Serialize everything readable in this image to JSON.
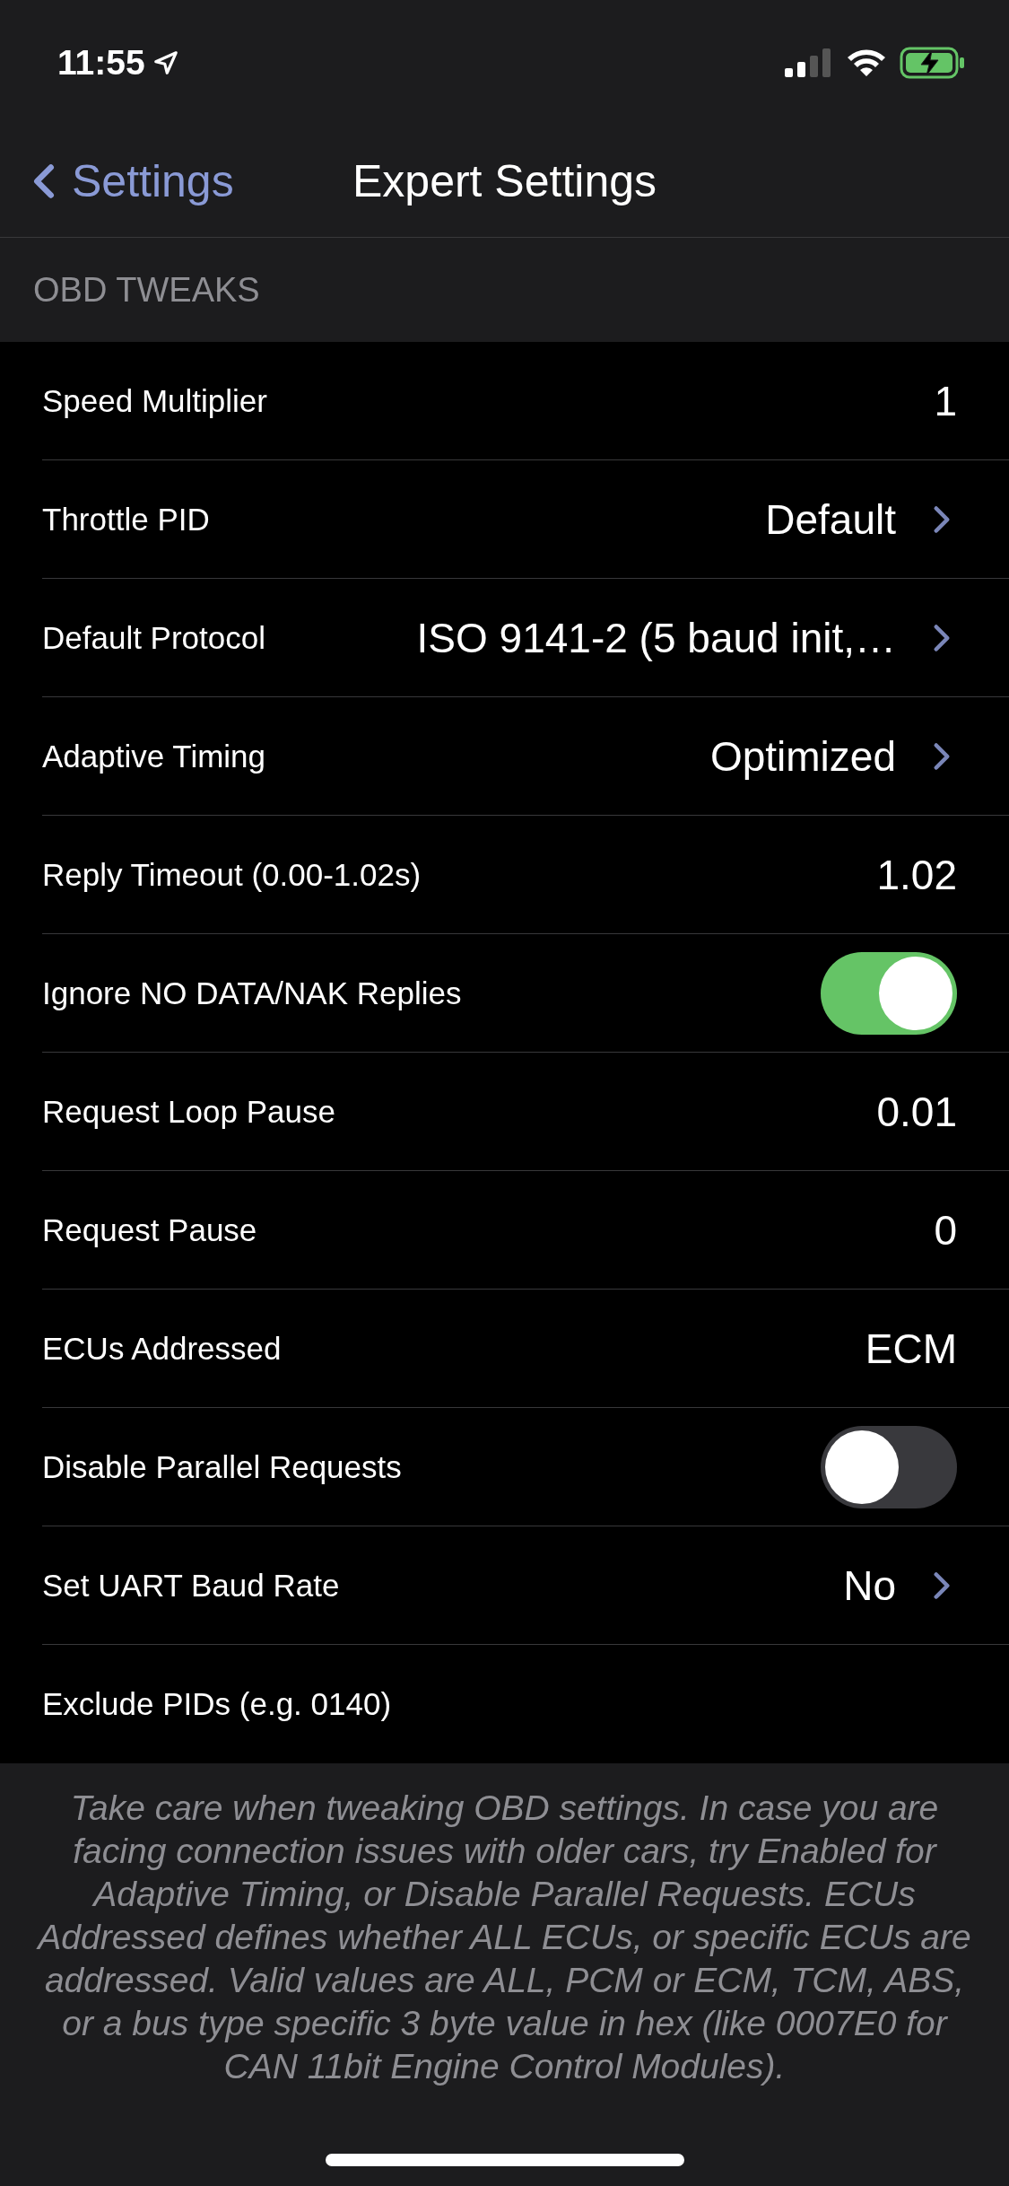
{
  "status_bar": {
    "time": "11:55"
  },
  "nav": {
    "back": "Settings",
    "title": "Expert Settings"
  },
  "section": {
    "header": "OBD TWEAKS",
    "rows": [
      {
        "kind": "value",
        "label": "Speed Multiplier",
        "value": "1"
      },
      {
        "kind": "link",
        "label": "Throttle PID",
        "value": "Default"
      },
      {
        "kind": "link",
        "label": "Default Protocol",
        "value": "ISO 9141-2 (5 baud init,…"
      },
      {
        "kind": "link",
        "label": "Adaptive Timing",
        "value": "Optimized"
      },
      {
        "kind": "value",
        "label": "Reply Timeout (0.00-1.02s)",
        "value": "1.02"
      },
      {
        "kind": "toggle",
        "label": "Ignore NO DATA/NAK Replies",
        "on": true
      },
      {
        "kind": "value",
        "label": "Request Loop Pause",
        "value": "0.01"
      },
      {
        "kind": "value",
        "label": "Request Pause",
        "value": "0"
      },
      {
        "kind": "value",
        "label": "ECUs Addressed",
        "value": "ECM"
      },
      {
        "kind": "toggle",
        "label": "Disable Parallel Requests",
        "on": false
      },
      {
        "kind": "link",
        "label": "Set UART Baud Rate",
        "value": "No"
      },
      {
        "kind": "plain",
        "label": "Exclude PIDs (e.g. 0140)"
      }
    ],
    "footer": "Take care when tweaking OBD settings. In case you are facing connection issues with older cars, try Enabled for Adaptive Timing, or Disable Parallel Requests. ECUs Addressed defines whether ALL ECUs, or specific ECUs are addressed. Valid values are ALL, PCM or ECM, TCM, ABS, or a bus type specific 3 byte value in hex (like 0007E0 for CAN 11bit Engine Control Modules)."
  }
}
